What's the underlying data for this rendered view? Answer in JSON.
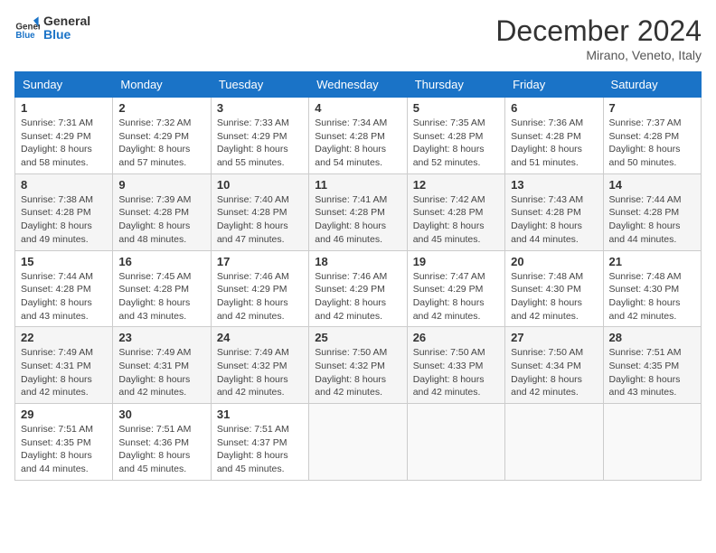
{
  "header": {
    "logo_line1": "General",
    "logo_line2": "Blue",
    "month_title": "December 2024",
    "location": "Mirano, Veneto, Italy"
  },
  "weekdays": [
    "Sunday",
    "Monday",
    "Tuesday",
    "Wednesday",
    "Thursday",
    "Friday",
    "Saturday"
  ],
  "weeks": [
    [
      {
        "day": "1",
        "sunrise": "Sunrise: 7:31 AM",
        "sunset": "Sunset: 4:29 PM",
        "daylight": "Daylight: 8 hours and 58 minutes."
      },
      {
        "day": "2",
        "sunrise": "Sunrise: 7:32 AM",
        "sunset": "Sunset: 4:29 PM",
        "daylight": "Daylight: 8 hours and 57 minutes."
      },
      {
        "day": "3",
        "sunrise": "Sunrise: 7:33 AM",
        "sunset": "Sunset: 4:29 PM",
        "daylight": "Daylight: 8 hours and 55 minutes."
      },
      {
        "day": "4",
        "sunrise": "Sunrise: 7:34 AM",
        "sunset": "Sunset: 4:28 PM",
        "daylight": "Daylight: 8 hours and 54 minutes."
      },
      {
        "day": "5",
        "sunrise": "Sunrise: 7:35 AM",
        "sunset": "Sunset: 4:28 PM",
        "daylight": "Daylight: 8 hours and 52 minutes."
      },
      {
        "day": "6",
        "sunrise": "Sunrise: 7:36 AM",
        "sunset": "Sunset: 4:28 PM",
        "daylight": "Daylight: 8 hours and 51 minutes."
      },
      {
        "day": "7",
        "sunrise": "Sunrise: 7:37 AM",
        "sunset": "Sunset: 4:28 PM",
        "daylight": "Daylight: 8 hours and 50 minutes."
      }
    ],
    [
      {
        "day": "8",
        "sunrise": "Sunrise: 7:38 AM",
        "sunset": "Sunset: 4:28 PM",
        "daylight": "Daylight: 8 hours and 49 minutes."
      },
      {
        "day": "9",
        "sunrise": "Sunrise: 7:39 AM",
        "sunset": "Sunset: 4:28 PM",
        "daylight": "Daylight: 8 hours and 48 minutes."
      },
      {
        "day": "10",
        "sunrise": "Sunrise: 7:40 AM",
        "sunset": "Sunset: 4:28 PM",
        "daylight": "Daylight: 8 hours and 47 minutes."
      },
      {
        "day": "11",
        "sunrise": "Sunrise: 7:41 AM",
        "sunset": "Sunset: 4:28 PM",
        "daylight": "Daylight: 8 hours and 46 minutes."
      },
      {
        "day": "12",
        "sunrise": "Sunrise: 7:42 AM",
        "sunset": "Sunset: 4:28 PM",
        "daylight": "Daylight: 8 hours and 45 minutes."
      },
      {
        "day": "13",
        "sunrise": "Sunrise: 7:43 AM",
        "sunset": "Sunset: 4:28 PM",
        "daylight": "Daylight: 8 hours and 44 minutes."
      },
      {
        "day": "14",
        "sunrise": "Sunrise: 7:44 AM",
        "sunset": "Sunset: 4:28 PM",
        "daylight": "Daylight: 8 hours and 44 minutes."
      }
    ],
    [
      {
        "day": "15",
        "sunrise": "Sunrise: 7:44 AM",
        "sunset": "Sunset: 4:28 PM",
        "daylight": "Daylight: 8 hours and 43 minutes."
      },
      {
        "day": "16",
        "sunrise": "Sunrise: 7:45 AM",
        "sunset": "Sunset: 4:28 PM",
        "daylight": "Daylight: 8 hours and 43 minutes."
      },
      {
        "day": "17",
        "sunrise": "Sunrise: 7:46 AM",
        "sunset": "Sunset: 4:29 PM",
        "daylight": "Daylight: 8 hours and 42 minutes."
      },
      {
        "day": "18",
        "sunrise": "Sunrise: 7:46 AM",
        "sunset": "Sunset: 4:29 PM",
        "daylight": "Daylight: 8 hours and 42 minutes."
      },
      {
        "day": "19",
        "sunrise": "Sunrise: 7:47 AM",
        "sunset": "Sunset: 4:29 PM",
        "daylight": "Daylight: 8 hours and 42 minutes."
      },
      {
        "day": "20",
        "sunrise": "Sunrise: 7:48 AM",
        "sunset": "Sunset: 4:30 PM",
        "daylight": "Daylight: 8 hours and 42 minutes."
      },
      {
        "day": "21",
        "sunrise": "Sunrise: 7:48 AM",
        "sunset": "Sunset: 4:30 PM",
        "daylight": "Daylight: 8 hours and 42 minutes."
      }
    ],
    [
      {
        "day": "22",
        "sunrise": "Sunrise: 7:49 AM",
        "sunset": "Sunset: 4:31 PM",
        "daylight": "Daylight: 8 hours and 42 minutes."
      },
      {
        "day": "23",
        "sunrise": "Sunrise: 7:49 AM",
        "sunset": "Sunset: 4:31 PM",
        "daylight": "Daylight: 8 hours and 42 minutes."
      },
      {
        "day": "24",
        "sunrise": "Sunrise: 7:49 AM",
        "sunset": "Sunset: 4:32 PM",
        "daylight": "Daylight: 8 hours and 42 minutes."
      },
      {
        "day": "25",
        "sunrise": "Sunrise: 7:50 AM",
        "sunset": "Sunset: 4:32 PM",
        "daylight": "Daylight: 8 hours and 42 minutes."
      },
      {
        "day": "26",
        "sunrise": "Sunrise: 7:50 AM",
        "sunset": "Sunset: 4:33 PM",
        "daylight": "Daylight: 8 hours and 42 minutes."
      },
      {
        "day": "27",
        "sunrise": "Sunrise: 7:50 AM",
        "sunset": "Sunset: 4:34 PM",
        "daylight": "Daylight: 8 hours and 42 minutes."
      },
      {
        "day": "28",
        "sunrise": "Sunrise: 7:51 AM",
        "sunset": "Sunset: 4:35 PM",
        "daylight": "Daylight: 8 hours and 43 minutes."
      }
    ],
    [
      {
        "day": "29",
        "sunrise": "Sunrise: 7:51 AM",
        "sunset": "Sunset: 4:35 PM",
        "daylight": "Daylight: 8 hours and 44 minutes."
      },
      {
        "day": "30",
        "sunrise": "Sunrise: 7:51 AM",
        "sunset": "Sunset: 4:36 PM",
        "daylight": "Daylight: 8 hours and 45 minutes."
      },
      {
        "day": "31",
        "sunrise": "Sunrise: 7:51 AM",
        "sunset": "Sunset: 4:37 PM",
        "daylight": "Daylight: 8 hours and 45 minutes."
      },
      null,
      null,
      null,
      null
    ]
  ]
}
